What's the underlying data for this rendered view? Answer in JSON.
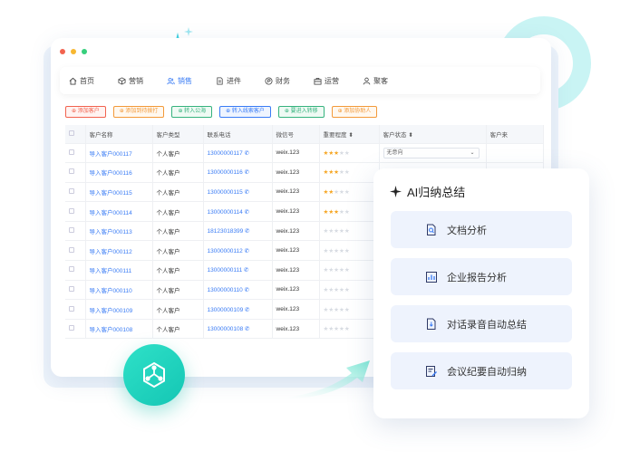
{
  "colors": {
    "accent": "#3a7cf5",
    "star_on": "#f6a623",
    "teal": "#14c6b4",
    "dot_red": "#f2634f",
    "dot_yellow": "#f7b731",
    "dot_green": "#36cf7c"
  },
  "nav": {
    "items": [
      {
        "label": "首页",
        "icon": "home-icon"
      },
      {
        "label": "营销",
        "icon": "cube-icon"
      },
      {
        "label": "销售",
        "icon": "users-icon",
        "active": true
      },
      {
        "label": "进件",
        "icon": "document-icon"
      },
      {
        "label": "财务",
        "icon": "coin-icon"
      },
      {
        "label": "运营",
        "icon": "briefcase-icon"
      },
      {
        "label": "聚客",
        "icon": "person-icon"
      }
    ]
  },
  "actions": [
    {
      "label": "添加客户",
      "color": "#f2634f",
      "bg": "#fff3f1"
    },
    {
      "label": "添加到待拨打",
      "color": "#f39a3a",
      "bg": "#fff8ef"
    },
    {
      "label": "转入公海",
      "color": "#36b37e",
      "bg": "#effaf4"
    },
    {
      "label": "转入线索客户",
      "color": "#3a7cf5",
      "bg": "#eef4ff"
    },
    {
      "label": "要进入转移",
      "color": "#36b37e",
      "bg": "#effaf4"
    },
    {
      "label": "添加协助人",
      "color": "#f39a3a",
      "bg": "#fff8ef"
    }
  ],
  "table": {
    "headers": [
      "客户名称",
      "客户类型",
      "联系电话",
      "微信号",
      "重要程度",
      "客户状态",
      "客户来"
    ],
    "rows": [
      {
        "name": "导入客户000117",
        "type": "个人客户",
        "phone": "13000000117",
        "wechat": "weix.123",
        "stars": 3,
        "status": "无意向"
      },
      {
        "name": "导入客户000116",
        "type": "个人客户",
        "phone": "13000000116",
        "wechat": "weix.123",
        "stars": 3,
        "status": ""
      },
      {
        "name": "导入客户000115",
        "type": "个人客户",
        "phone": "13000000115",
        "wechat": "weix.123",
        "stars": 2,
        "status": ""
      },
      {
        "name": "导入客户000114",
        "type": "个人客户",
        "phone": "13000000114",
        "wechat": "weix.123",
        "stars": 3,
        "status": ""
      },
      {
        "name": "导入客户000113",
        "type": "个人客户",
        "phone": "18123018399",
        "wechat": "weix.123",
        "stars": 0,
        "status": ""
      },
      {
        "name": "导入客户000112",
        "type": "个人客户",
        "phone": "13000000112",
        "wechat": "weix.123",
        "stars": 0,
        "status": ""
      },
      {
        "name": "导入客户000111",
        "type": "个人客户",
        "phone": "13000000111",
        "wechat": "weix.123",
        "stars": 0,
        "status": ""
      },
      {
        "name": "导入客户000110",
        "type": "个人客户",
        "phone": "13000000110",
        "wechat": "weix.123",
        "stars": 0,
        "status": ""
      },
      {
        "name": "导入客户000109",
        "type": "个人客户",
        "phone": "13000000109",
        "wechat": "weix.123",
        "stars": 0,
        "status": ""
      },
      {
        "name": "导入客户000108",
        "type": "个人客户",
        "phone": "13000000108",
        "wechat": "weix.123",
        "stars": 0,
        "status": ""
      }
    ]
  },
  "ai_panel": {
    "title": "AI归纳总结",
    "items": [
      {
        "label": "文档分析",
        "icon": "doc-search-icon"
      },
      {
        "label": "企业报告分析",
        "icon": "report-chart-icon"
      },
      {
        "label": "对话录音自动总结",
        "icon": "audio-file-icon"
      },
      {
        "label": "会议纪要自动归纳",
        "icon": "meeting-notes-icon"
      }
    ]
  }
}
